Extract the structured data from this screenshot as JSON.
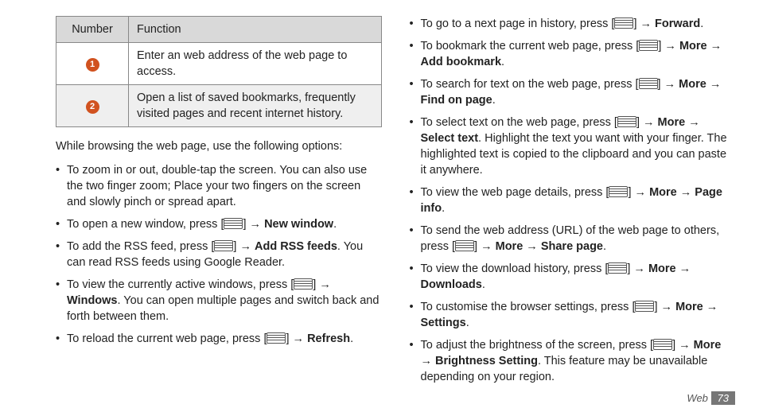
{
  "table": {
    "headers": [
      "Number",
      "Function"
    ],
    "rows": [
      {
        "num": "1",
        "func": "Enter an web address of the web page to access."
      },
      {
        "num": "2",
        "func": "Open a list of saved bookmarks, frequently visited pages and recent internet history."
      }
    ]
  },
  "intro": "While browsing the web page, use the following options:",
  "left_items": [
    {
      "pre": "To zoom in or out, double-tap the screen. You can also use the two finger zoom; Place your two fingers on the screen and slowly pinch or spread apart.",
      "icon": false
    },
    {
      "pre": "To open a new window, press [",
      "icon": true,
      "mid": "] → ",
      "b1": "New window",
      "post": "."
    },
    {
      "pre": "To add the RSS feed, press [",
      "icon": true,
      "mid": "] → ",
      "b1": "Add RSS feeds",
      "post": ". You can read RSS feeds using Google Reader."
    },
    {
      "pre": "To view the currently active windows, press [",
      "icon": true,
      "mid": "] → ",
      "b1": "Windows",
      "post": ". You can open multiple pages and switch back and forth between them."
    },
    {
      "pre": "To reload the current web page, press [",
      "icon": true,
      "mid": "] → ",
      "b1": "Refresh",
      "post": "."
    }
  ],
  "right_items": [
    {
      "pre": "To go to a next page in history, press [",
      "icon": true,
      "mid": "] → ",
      "b1": "Forward",
      "post": "."
    },
    {
      "pre": "To bookmark the current web page, press [",
      "icon": true,
      "mid": "] → ",
      "b1": "More",
      "arrow": " → ",
      "b2": "Add bookmark",
      "post": "."
    },
    {
      "pre": "To search for text on the web page, press [",
      "icon": true,
      "mid": "] → ",
      "b1": "More",
      "arrow": " → ",
      "b2": "Find on page",
      "post": "."
    },
    {
      "pre": "To select text on the web page, press [",
      "icon": true,
      "mid": "] → ",
      "b1": "More",
      "arrow": " → ",
      "b2": "Select text",
      "post": ". Highlight the text you want with your finger. The highlighted text is copied to the clipboard and you can paste it anywhere."
    },
    {
      "pre": "To view the web page details, press [",
      "icon": true,
      "mid": "] → ",
      "b1": "More",
      "arrow": " → ",
      "b2": "Page info",
      "post": "."
    },
    {
      "pre": "To send the web address (URL) of the web page to others, press [",
      "icon": true,
      "mid": "] → ",
      "b1": "More",
      "arrow": " → ",
      "b2": "Share page",
      "post": "."
    },
    {
      "pre": "To view the download history, press [",
      "icon": true,
      "mid": "] → ",
      "b1": "More",
      "arrow": " → ",
      "b2": "Downloads",
      "post": "."
    },
    {
      "pre": "To customise the browser settings, press [",
      "icon": true,
      "mid": "] → ",
      "b1": "More",
      "arrow": " → ",
      "b2": "Settings",
      "post": "."
    },
    {
      "pre": "To adjust the brightness of the screen, press [",
      "icon": true,
      "mid": "] → ",
      "b1": "More",
      "arrow": " → ",
      "b2": "Brightness Setting",
      "post": ". This feature may be unavailable depending on your region."
    }
  ],
  "footer": {
    "section": "Web",
    "page": "73"
  }
}
